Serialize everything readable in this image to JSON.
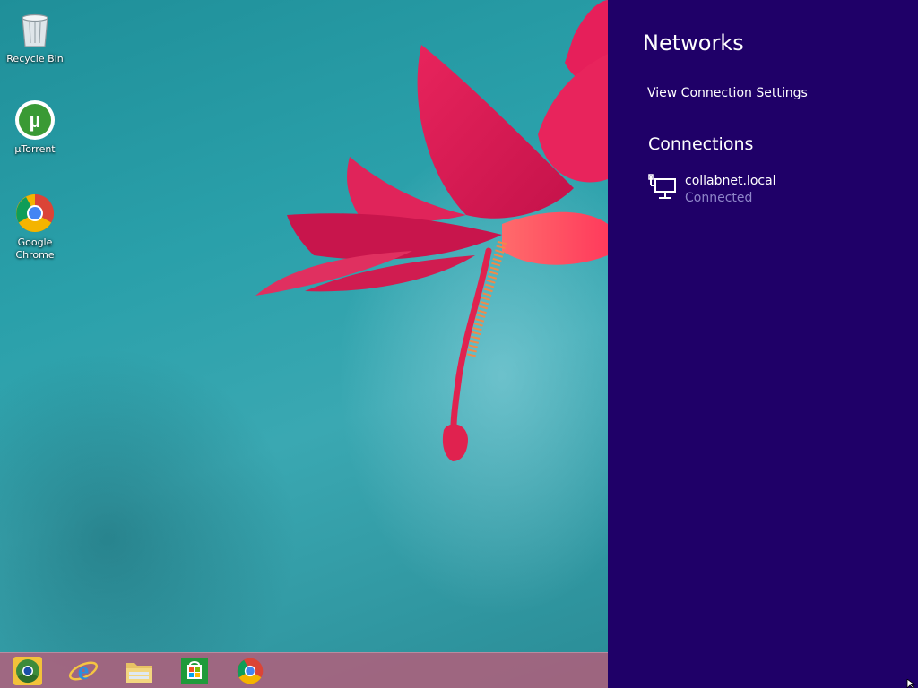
{
  "desktop": {
    "icons": [
      {
        "label": "Recycle Bin",
        "icon": "recycle-bin-icon"
      },
      {
        "label": "µTorrent",
        "icon": "utorrent-icon"
      },
      {
        "label": "Google Chrome",
        "icon": "chrome-icon"
      }
    ]
  },
  "taskbar": {
    "items": [
      {
        "icon": "chrome-canary-icon"
      },
      {
        "icon": "internet-explorer-icon"
      },
      {
        "icon": "file-explorer-icon"
      },
      {
        "icon": "store-icon"
      },
      {
        "icon": "chrome-icon"
      }
    ]
  },
  "pane": {
    "title": "Networks",
    "view_settings_label": "View Connection Settings",
    "connections_heading": "Connections",
    "connections": [
      {
        "name": "collabnet.local",
        "status": "Connected",
        "icon": "wired-network-icon"
      }
    ]
  },
  "colors": {
    "pane_background": "#1f0068",
    "status_text": "#8f86c9",
    "taskbar": "#be5a78",
    "wallpaper": "#2aa0aa"
  }
}
